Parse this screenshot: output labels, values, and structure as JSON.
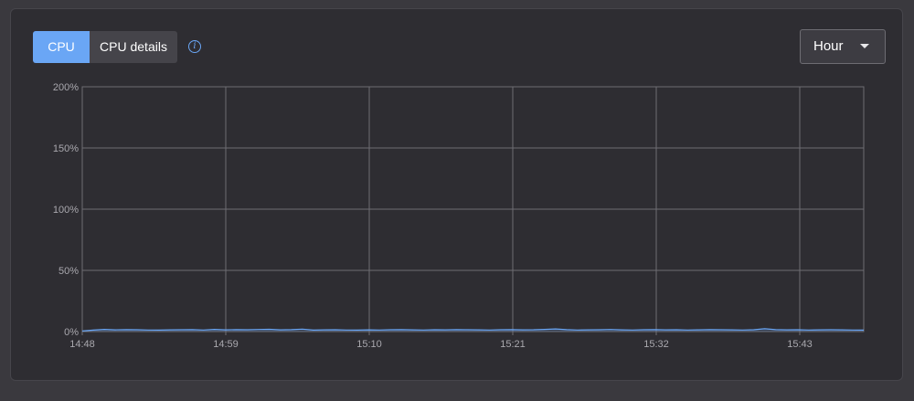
{
  "tabs": [
    {
      "label": "CPU",
      "active": true
    },
    {
      "label": "CPU details",
      "active": false
    }
  ],
  "info": {
    "icon": "info-icon",
    "glyph": "i"
  },
  "range_select": {
    "value": "Hour",
    "icon": "chevron-down-icon"
  },
  "colors": {
    "accent": "#6aa6f5",
    "panel": "#2e2d32",
    "grid": "#6e6d73",
    "line": "#6aa6f5"
  },
  "chart_data": {
    "type": "area",
    "x_ticks": [
      "14:48",
      "14:59",
      "15:10",
      "15:21",
      "15:32",
      "15:43"
    ],
    "y_ticks": [
      "0%",
      "50%",
      "100%",
      "150%",
      "200%"
    ],
    "ylim": [
      0,
      200
    ],
    "grid": true,
    "series": [
      {
        "values": [
          0.5,
          1.2,
          1.8,
          1.4,
          1.6,
          1.5,
          1.3,
          1.2,
          1.4,
          1.5,
          1.6,
          1.3,
          1.8,
          1.4,
          1.6,
          1.5,
          1.7,
          1.9,
          1.4,
          1.6,
          2.0,
          1.2,
          1.4,
          1.5,
          1.3,
          1.2,
          1.4,
          1.3,
          1.5,
          1.6,
          1.4,
          1.3,
          1.5,
          1.4,
          1.6,
          1.5,
          1.4,
          1.3,
          1.5,
          1.6,
          1.4,
          1.5,
          1.8,
          2.2,
          1.6,
          1.3,
          1.4,
          1.5,
          1.7,
          1.4,
          1.3,
          1.5,
          1.6,
          1.4,
          1.5,
          1.3,
          1.4,
          1.6,
          1.5,
          1.4,
          1.3,
          1.5,
          2.3,
          1.6,
          1.4,
          1.5,
          1.3,
          1.4,
          1.5,
          1.4,
          1.3,
          1.2
        ]
      }
    ]
  }
}
